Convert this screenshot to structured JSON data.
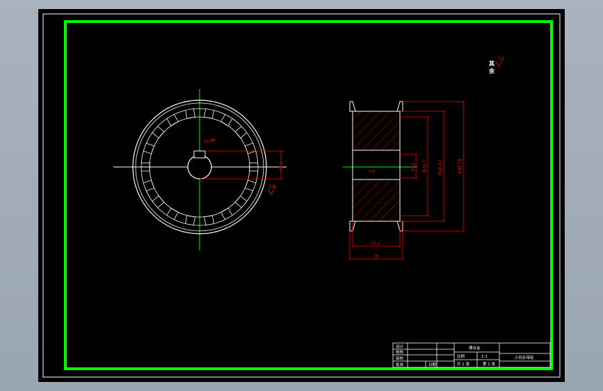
{
  "colors": {
    "window_bg": "#9aa5b2",
    "canvas_bg": "#000000",
    "border_outer": "#ffffff",
    "border_inner": "#00ff00",
    "geometry": "#ffffff",
    "centerline": "#00ff00",
    "dimension": "#ff0000",
    "hatch": "#ff0000",
    "title_block_text": "#ffffff"
  },
  "annotations": {
    "roughness_other": "其",
    "roughness_rest": "余",
    "roughness_value": "3.2",
    "front_roughness_value": "1.6",
    "keyway_width_dim": "11.80",
    "bore_dim": "2.6",
    "key_height_dim": "R1.5",
    "hub_width_dim": "11.0",
    "total_width_dim": "16",
    "bore_diameter_dim": "Φ12",
    "hub_diameter_dim": "Φ24.5",
    "root_diameter_dim": "Φ26.47",
    "outer_diameter_dim": "Φ30.75",
    "hub_small_dim": "1.6"
  },
  "title_block": {
    "design_label": "设计",
    "check_label": "校核",
    "review_label": "审核",
    "approve_label": "批准",
    "date_label": "日期",
    "company": "哪合金",
    "scale_label": "比例",
    "scale_value": "2:1",
    "sheet_total": "共 1 张",
    "sheet_index": "第 1 张",
    "part_name": "小同步带轮"
  }
}
